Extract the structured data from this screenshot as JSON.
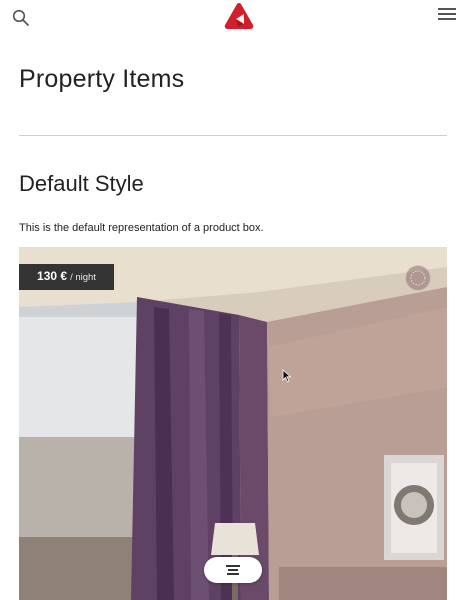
{
  "header": {
    "search_icon": "search-icon",
    "logo_icon": "red-triangle-logo",
    "menu_icon": "hamburger-menu-icon"
  },
  "page": {
    "title": "Property Items"
  },
  "section": {
    "title": "Default Style",
    "description": "This is the default representation of a product box."
  },
  "product": {
    "price": "130 €",
    "price_unit": "/ night",
    "image_subject": "hotel room interior with purple curtains",
    "favorite_icon": "heart-circle-icon",
    "filter_icon": "filter-lines-icon"
  },
  "colors": {
    "logo_red": "#d11f2b",
    "price_tag_bg": "#333333",
    "divider": "#cfcfcf"
  }
}
